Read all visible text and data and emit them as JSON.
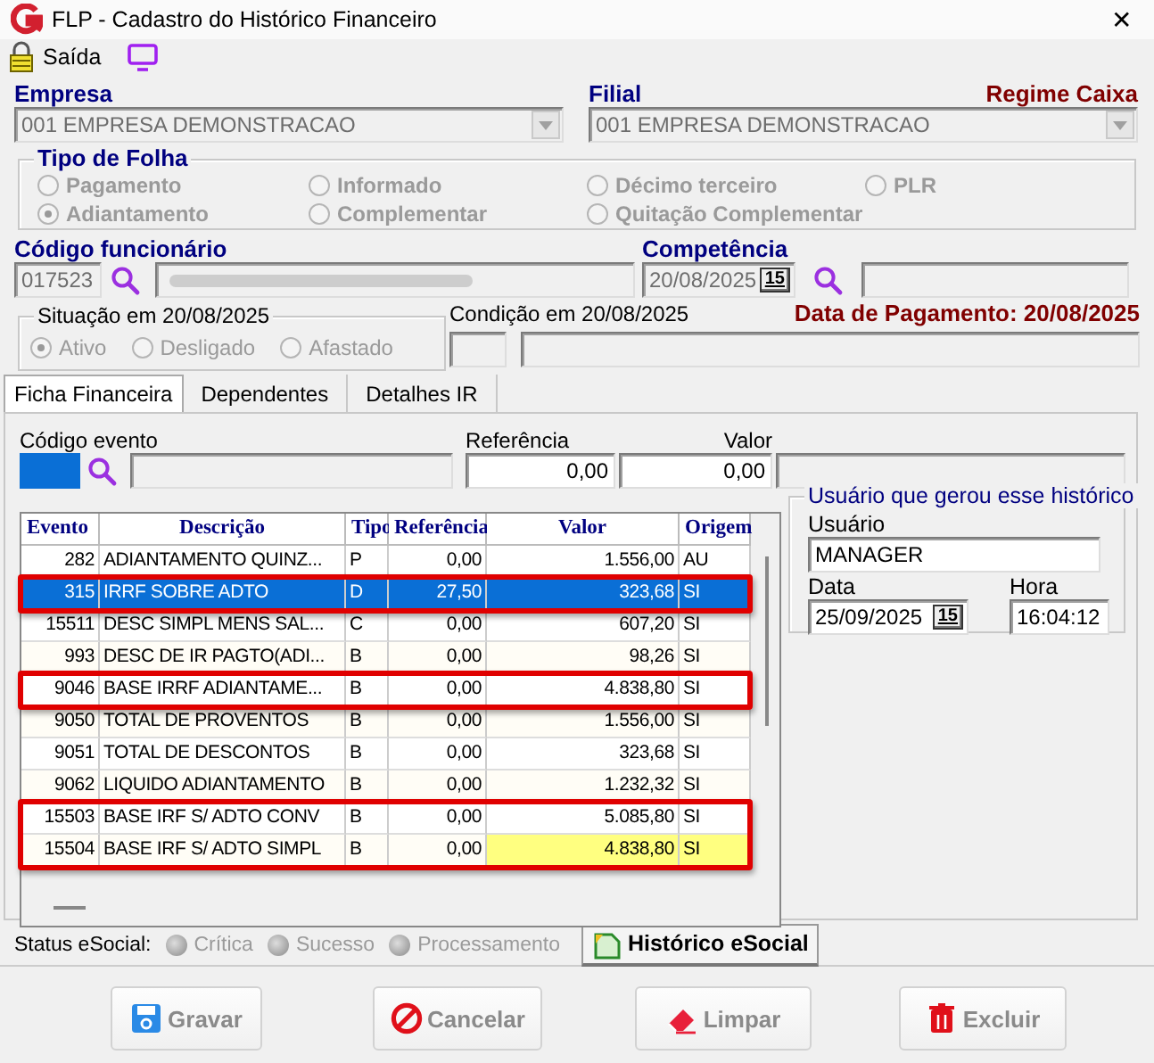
{
  "window": {
    "title": "FLP - Cadastro do Histórico Financeiro",
    "close": "✕"
  },
  "toolbar": {
    "exit_label": "Saída"
  },
  "empresa": {
    "label": "Empresa",
    "value": "001 EMPRESA DEMONSTRACAO"
  },
  "filial": {
    "label": "Filial",
    "value": "001 EMPRESA DEMONSTRACAO",
    "regime": "Regime Caixa"
  },
  "tipo_de_folha": {
    "title": "Tipo de Folha",
    "disabled": true,
    "options": [
      {
        "label": "Pagamento",
        "selected": false
      },
      {
        "label": "Informado",
        "selected": false
      },
      {
        "label": "Décimo terceiro",
        "selected": false
      },
      {
        "label": "PLR",
        "selected": false
      },
      {
        "label": "Adiantamento",
        "selected": true
      },
      {
        "label": "Complementar",
        "selected": false
      },
      {
        "label": "Quitação Complementar",
        "selected": false
      }
    ]
  },
  "funcionario": {
    "label": "Código funcionário",
    "code": "017523"
  },
  "competencia": {
    "label": "Competência",
    "value": "20/08/2025",
    "calendar": "15"
  },
  "situacao": {
    "title": "Situação em  20/08/2025",
    "disabled": true,
    "options": [
      {
        "label": "Ativo",
        "selected": true
      },
      {
        "label": "Desligado",
        "selected": false
      },
      {
        "label": "Afastado",
        "selected": false
      }
    ]
  },
  "condicao": {
    "label": "Condição em 20/08/2025"
  },
  "data_pagamento": "Data de Pagamento: 20/08/2025",
  "tabs": [
    {
      "label": "Ficha Financeira",
      "selected": true
    },
    {
      "label": "Dependentes",
      "selected": false
    },
    {
      "label": "Detalhes IR",
      "selected": false
    }
  ],
  "evento": {
    "label": "Código evento",
    "referencia_label": "Referência",
    "referencia": "0,00",
    "valor_label": "Valor",
    "valor": "0,00"
  },
  "table": {
    "columns": [
      "Evento",
      "Descrição",
      "Tipo",
      "Referência",
      "Valor",
      "Origem"
    ],
    "rows": [
      {
        "cells": [
          "282",
          "ADIANTAMENTO QUINZ...",
          "P",
          "0,00",
          "1.556,00",
          "AU"
        ],
        "selected": false,
        "outlined": false,
        "highlighted": false
      },
      {
        "cells": [
          "315",
          "IRRF SOBRE ADTO",
          "D",
          "27,50",
          "323,68",
          "SI"
        ],
        "selected": true,
        "outlined": true,
        "highlighted": false
      },
      {
        "cells": [
          "15511",
          "DESC SIMPL MENS SAL...",
          "C",
          "0,00",
          "607,20",
          "SI"
        ],
        "selected": false,
        "outlined": false,
        "highlighted": false
      },
      {
        "cells": [
          "993",
          "DESC DE IR PAGTO(ADI...",
          "B",
          "0,00",
          "98,26",
          "SI"
        ],
        "selected": false,
        "outlined": false,
        "highlighted": false
      },
      {
        "cells": [
          "9046",
          "BASE IRRF ADIANTAME...",
          "B",
          "0,00",
          "4.838,80",
          "SI"
        ],
        "selected": false,
        "outlined": true,
        "highlighted": false
      },
      {
        "cells": [
          "9050",
          "TOTAL DE PROVENTOS",
          "B",
          "0,00",
          "1.556,00",
          "SI"
        ],
        "selected": false,
        "outlined": false,
        "highlighted": false
      },
      {
        "cells": [
          "9051",
          "TOTAL DE DESCONTOS",
          "B",
          "0,00",
          "323,68",
          "SI"
        ],
        "selected": false,
        "outlined": false,
        "highlighted": false
      },
      {
        "cells": [
          "9062",
          "LIQUIDO ADIANTAMENTO",
          "B",
          "0,00",
          "1.232,32",
          "SI"
        ],
        "selected": false,
        "outlined": false,
        "highlighted": false
      },
      {
        "cells": [
          "15503",
          "BASE IRF S/ ADTO CONV",
          "B",
          "0,00",
          "5.085,80",
          "SI"
        ],
        "selected": false,
        "outlined": true,
        "highlighted": false
      },
      {
        "cells": [
          "15504",
          "BASE IRF S/ ADTO SIMPL",
          "B",
          "0,00",
          "4.838,80",
          "SI"
        ],
        "selected": false,
        "outlined": true,
        "highlighted": true
      }
    ]
  },
  "user_box": {
    "title": "Usuário que gerou esse histórico",
    "usuario_label": "Usuário",
    "usuario": "MANAGER",
    "data_label": "Data",
    "data": "25/09/2025",
    "calendar": "15",
    "hora_label": "Hora",
    "hora": "16:04:12"
  },
  "status": {
    "label": "Status eSocial:",
    "disabled": true,
    "options": [
      {
        "label": "Crítica",
        "selected": false
      },
      {
        "label": "Sucesso",
        "selected": false
      },
      {
        "label": "Processamento",
        "selected": false
      }
    ],
    "history_button": "Histórico eSocial"
  },
  "buttons": [
    {
      "label": "Gravar",
      "kind": "save"
    },
    {
      "label": "Cancelar",
      "kind": "cancel"
    },
    {
      "label": "Limpar",
      "kind": "clear"
    },
    {
      "label": "Excluir",
      "kind": "delete"
    }
  ]
}
